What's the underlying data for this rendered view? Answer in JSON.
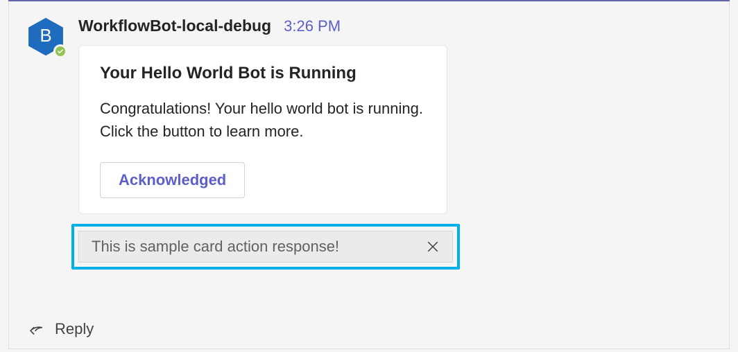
{
  "message": {
    "sender": "WorkflowBot-local-debug",
    "avatarLetter": "B",
    "timestamp": "3:26 PM",
    "card": {
      "title": "Your Hello World Bot is Running",
      "body": "Congratulations! Your hello world bot is running. Click the button to learn more.",
      "actionLabel": "Acknowledged"
    },
    "response": {
      "text": "This is sample card action response!"
    }
  },
  "reply": {
    "label": "Reply"
  },
  "colors": {
    "accent": "#5b5fc7",
    "highlight": "#00b0e8",
    "avatarBg": "#1f6cbf",
    "presence": "#92c353"
  }
}
